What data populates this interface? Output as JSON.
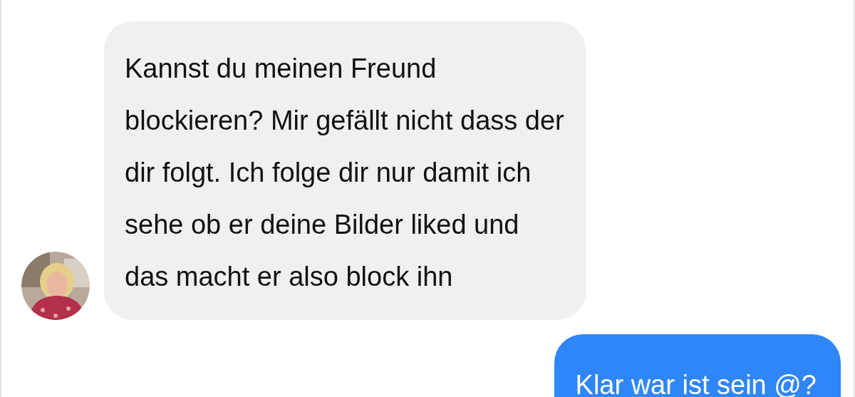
{
  "messages": [
    {
      "kind": "received",
      "text": "Kannst du meinen Freund\nblockieren? Mir gefällt nicht dass der\ndir folgt. Ich folge dir nur damit ich\nsehe ob er deine Bilder liked und\ndas macht er also block ihn"
    },
    {
      "kind": "sent",
      "text": "Klar war ist sein @?"
    }
  ]
}
